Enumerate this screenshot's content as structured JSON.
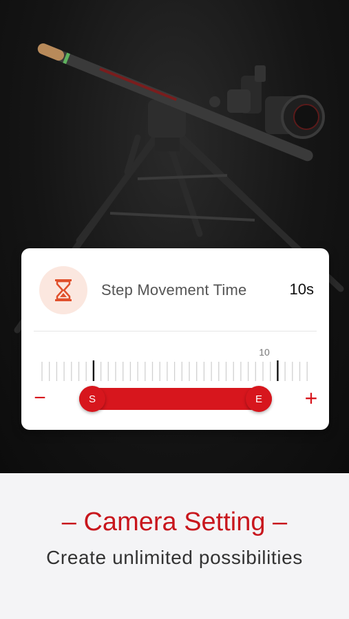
{
  "setting": {
    "label": "Step Movement Time",
    "value": "10s",
    "ruler_value_label": "10",
    "start_marker": "S",
    "end_marker": "E",
    "decrease_symbol": "−",
    "increase_symbol": "+"
  },
  "promo": {
    "headline": "– Camera Setting –",
    "subheadline": "Create unlimited possibilities"
  },
  "colors": {
    "accent": "#d7161d",
    "icon_bg": "#fbe7df",
    "hero_bg": "#151515"
  },
  "icons": {
    "timer": "hourglass-icon"
  }
}
